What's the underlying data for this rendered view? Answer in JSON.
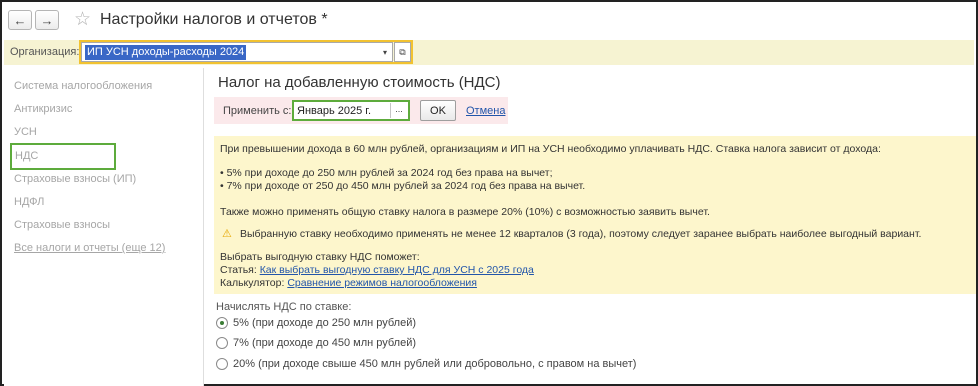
{
  "window": {
    "title": "Настройки налогов и отчетов *",
    "back_icon": "←",
    "forward_icon": "→",
    "favorite_icon": "☆"
  },
  "organization": {
    "label": "Организация:",
    "value": "ИП УСН доходы-расходы 2024",
    "dropdown_icon": "▾",
    "open_icon": "⧉"
  },
  "sidebar": {
    "items": [
      {
        "label": "Система налогообложения"
      },
      {
        "label": "Антикризис"
      },
      {
        "label": "УСН"
      },
      {
        "label": "НДС"
      },
      {
        "label": "Страховые взносы (ИП)"
      },
      {
        "label": "НДФЛ"
      },
      {
        "label": "Страховые взносы"
      },
      {
        "label": "Все налоги и отчеты (еще 12)"
      }
    ]
  },
  "main": {
    "title": "Налог на добавленную стоимость (НДС)",
    "apply": {
      "label": "Применить с:",
      "period_value": "Январь 2025 г.",
      "period_button": "...",
      "ok_label": "OK",
      "cancel_label": "Отмена"
    },
    "info": {
      "line1": "При превышении дохода в 60 млн рублей, организациям и ИП на УСН необходимо уплачивать НДС. Ставка налога зависит от дохода:",
      "bullet1": "• 5% при доходе до 250 млн рублей за 2024 год без права на вычет;",
      "bullet2": "• 7% при доходе от 250 до 450 млн рублей за 2024 год без права на вычет.",
      "line2": "Также можно применять общую ставку налога в размере 20% (10%) с возможностью заявить вычет.",
      "warning_icon": "⚠",
      "warning": "Выбранную ставку необходимо применять не менее 12 кварталов (3 года), поэтому следует заранее выбрать наиболее выгодный вариант.",
      "help_title": "Выбрать выгодную ставку НДС поможет:",
      "article_label": "Статья:",
      "article_link": "Как выбрать выгодную ставку НДС для УСН с 2025 года",
      "calc_label": "Калькулятор:",
      "calc_link": "Сравнение режимов налогообложения"
    },
    "vat_rate": {
      "label": "Начислять НДС по ставке:",
      "options": [
        {
          "label": "5% (при доходе до 250 млн рублей)",
          "checked": true
        },
        {
          "label": "7% (при доходе до 450 млн рублей)",
          "checked": false
        },
        {
          "label": "20% (при доходе свыше 450 млн рублей или добровольно, с правом на вычет)",
          "checked": false
        }
      ]
    }
  },
  "colors": {
    "highlight_yellow": "#f2c230",
    "highlight_green": "#5dab3c",
    "selection_blue": "#3967c6",
    "info_background": "#fdf6cc",
    "link_blue": "#2255aa"
  }
}
